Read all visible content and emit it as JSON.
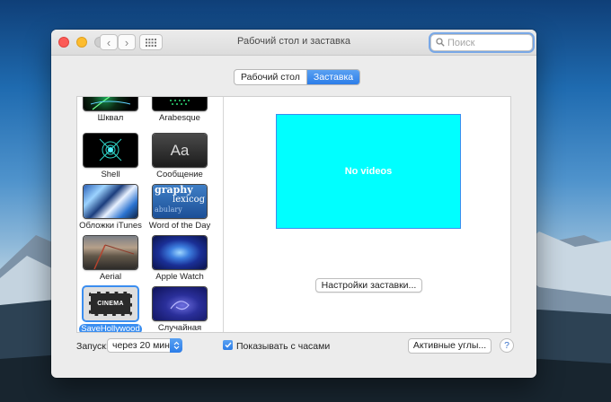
{
  "window": {
    "title": "Рабочий стол и заставка"
  },
  "search": {
    "placeholder": "Поиск"
  },
  "tabs": [
    {
      "label": "Рабочий стол",
      "active": false
    },
    {
      "label": "Заставка",
      "active": true
    }
  ],
  "screensavers": [
    {
      "name": "Шквал",
      "icon": "flurry-thumbnail"
    },
    {
      "name": "Arabesque",
      "icon": "arabesque-thumbnail"
    },
    {
      "name": "Shell",
      "icon": "shell-thumbnail"
    },
    {
      "name": "Сообщение",
      "icon": "message-thumbnail",
      "glyph": "Aa"
    },
    {
      "name": "Обложки iTunes",
      "icon": "itunes-artwork-thumbnail"
    },
    {
      "name": "Word of the Day",
      "icon": "word-of-day-thumbnail",
      "lines": [
        "graphy",
        "lexicog",
        "abulary"
      ]
    },
    {
      "name": "Aerial",
      "icon": "aerial-thumbnail"
    },
    {
      "name": "Apple Watch",
      "icon": "apple-watch-thumbnail"
    },
    {
      "name": "SaveHollywood",
      "icon": "cinema-ticket-thumbnail",
      "glyph": "CINEMA",
      "selected": true
    },
    {
      "name": "Случайная",
      "icon": "random-thumbnail"
    }
  ],
  "preview": {
    "message": "No videos",
    "background": "#00ffff"
  },
  "options_button": "Настройки заставки...",
  "start": {
    "label": "Запуск:",
    "value": "через 20 мин"
  },
  "show_clock": {
    "label": "Показывать с часами",
    "checked": true
  },
  "hot_corners_button": "Активные углы...",
  "help_button": "?",
  "colors": {
    "accent": "#3b8ef0",
    "close": "#fc5b57",
    "minimize": "#fdbc2e"
  }
}
